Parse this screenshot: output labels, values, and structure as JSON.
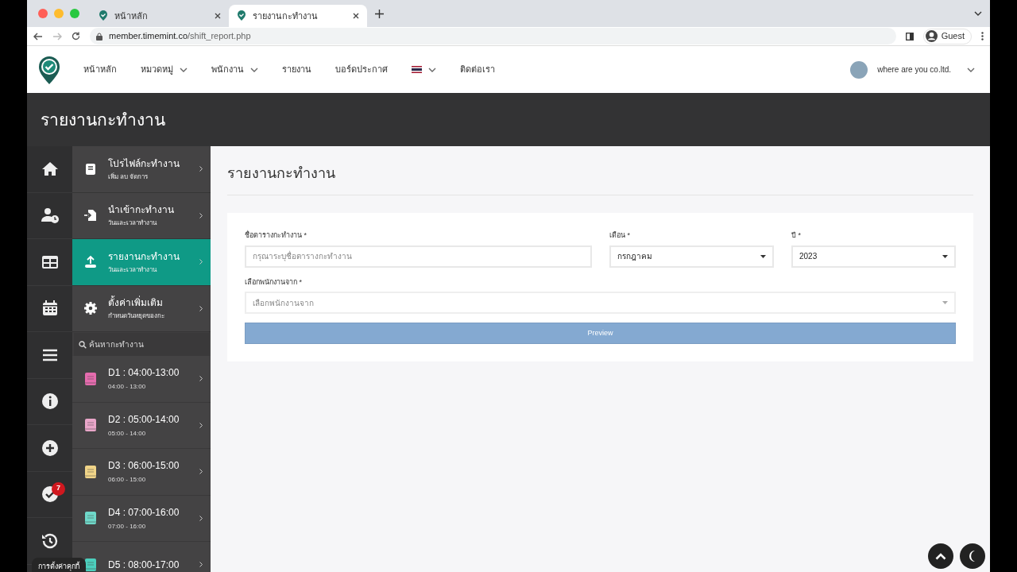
{
  "browser": {
    "tabs": [
      {
        "title": "หน้าหลัก",
        "selected": false
      },
      {
        "title": "รายงานกะทำงาน",
        "selected": true
      }
    ],
    "url_host": "member.timemint.co",
    "url_path": "/shift_report.php",
    "profile": "Guest"
  },
  "nav": {
    "items": [
      {
        "label": "หน้าหลัก",
        "dropdown": false
      },
      {
        "label": "หมวดหมู่",
        "dropdown": true
      },
      {
        "label": "พนักงาน",
        "dropdown": true
      },
      {
        "label": "รายงาน",
        "dropdown": false
      },
      {
        "label": "บอร์ดประกาศ",
        "dropdown": false
      },
      {
        "label": "ติดต่อเรา",
        "dropdown": false
      }
    ],
    "company": "where are you co.ltd."
  },
  "page_title": "รายงานกะทำงาน",
  "rail": {
    "badge": "7",
    "tooltip": "การตั้งค่าคุกกี้"
  },
  "menu": [
    {
      "title": "โปรไฟล์กะทำงาน",
      "subtitle": "เพิ่ม ลบ จัดการ",
      "selected": false
    },
    {
      "title": "นำเข้ากะทำงาน",
      "subtitle": "วันและเวลาทำงาน",
      "selected": false
    },
    {
      "title": "รายงานกะทำงาน",
      "subtitle": "วันและเวลาทำงาน",
      "selected": true
    },
    {
      "title": "ตั้งค่าเพิ่มเติม",
      "subtitle": "กำหนดวันหยุดของกะ",
      "selected": false
    }
  ],
  "search": {
    "placeholder": "ค้นหากะทำงาน"
  },
  "shifts": [
    {
      "title": "D1 : 04:00-13:00",
      "time": "04:00 - 13:00",
      "color": "#e56cae"
    },
    {
      "title": "D2 : 05:00-14:00",
      "time": "05:00 - 14:00",
      "color": "#e9a6c9"
    },
    {
      "title": "D3 : 06:00-15:00",
      "time": "06:00 - 15:00",
      "color": "#f0d488"
    },
    {
      "title": "D4 : 07:00-16:00",
      "time": "07:00 - 16:00",
      "color": "#6fd8c9"
    },
    {
      "title": "D5 : 08:00-17:00",
      "color": "#4ccfbd"
    }
  ],
  "content": {
    "title": "รายงานกะทำงาน",
    "form": {
      "name_label": "ชื่อตารางกะทำงาน *",
      "name_placeholder": "กรุณาระบุชื่อตารางกะทำงาน",
      "month_label": "เดือน *",
      "month_value": "กรกฎาคม",
      "year_label": "ปี *",
      "year_value": "2023",
      "employee_label": "เลือกพนักงานจาก *",
      "employee_placeholder": "เลือกพนักงานจาก",
      "button": "Preview"
    }
  }
}
